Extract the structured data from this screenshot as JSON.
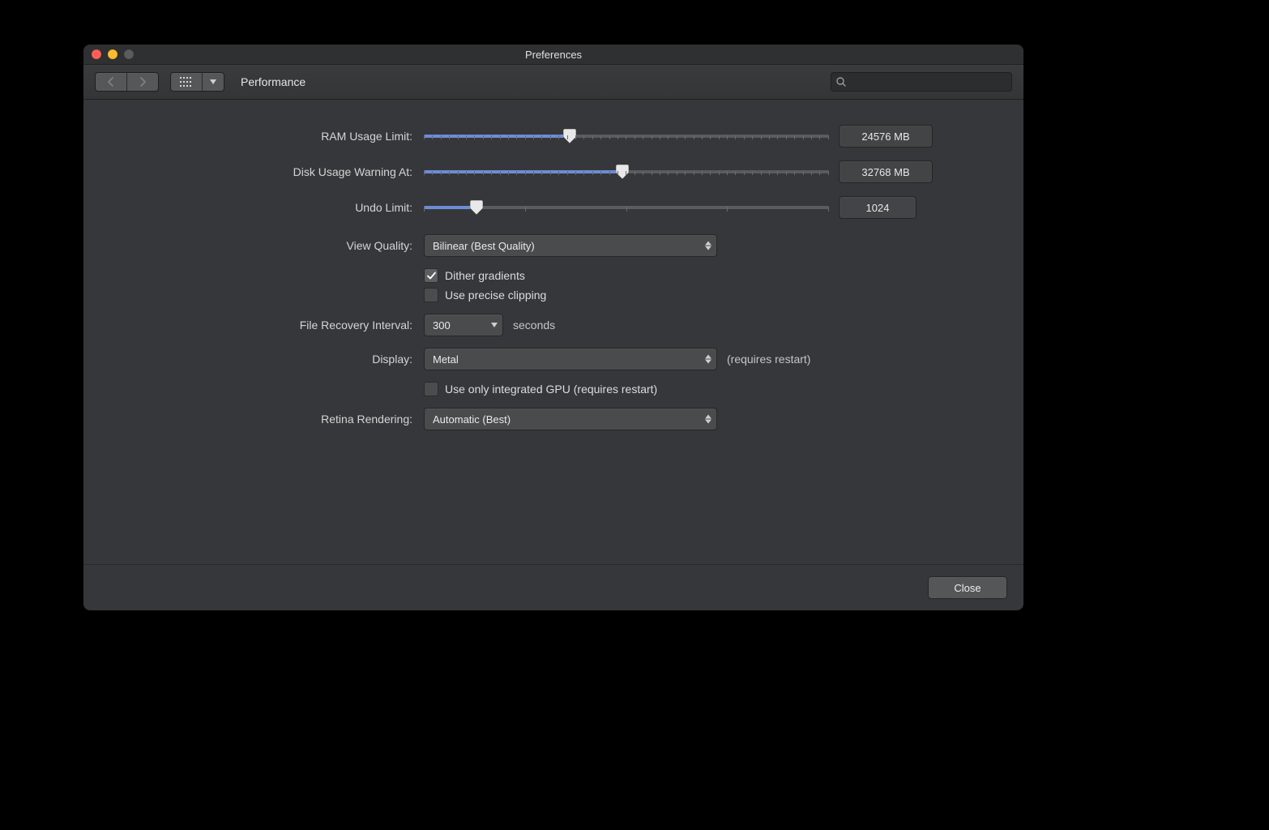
{
  "window": {
    "title": "Preferences",
    "section": "Performance"
  },
  "search": {
    "placeholder": ""
  },
  "sliders": {
    "ram": {
      "label": "RAM Usage Limit:",
      "value_text": "24576 MB",
      "percent": 36,
      "tick_count": 49
    },
    "disk": {
      "label": "Disk Usage Warning At:",
      "value_text": "32768 MB",
      "percent": 49,
      "tick_count": 49
    },
    "undo": {
      "label": "Undo Limit:",
      "value_text": "1024",
      "percent": 13,
      "tick_count": 5
    }
  },
  "view_quality": {
    "label": "View Quality:",
    "selected": "Bilinear (Best Quality)",
    "dither_label": "Dither gradients",
    "dither_checked": true,
    "clip_label": "Use precise clipping",
    "clip_checked": false
  },
  "recovery": {
    "label": "File Recovery Interval:",
    "value": "300",
    "unit": "seconds"
  },
  "display": {
    "label": "Display:",
    "selected": "Metal",
    "hint": "(requires restart)",
    "igpu_label": "Use only integrated GPU (requires restart)",
    "igpu_checked": false
  },
  "retina": {
    "label": "Retina Rendering:",
    "selected": "Automatic (Best)"
  },
  "footer": {
    "close": "Close"
  }
}
